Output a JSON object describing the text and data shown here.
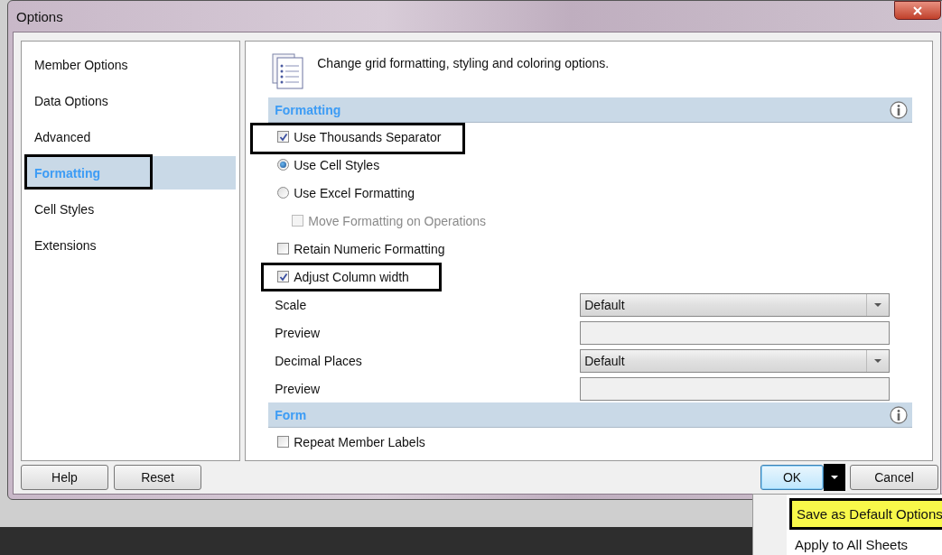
{
  "window": {
    "title": "Options"
  },
  "sidebar": {
    "items": [
      {
        "label": "Member Options",
        "selected": false,
        "highlighted": false
      },
      {
        "label": "Data Options",
        "selected": false,
        "highlighted": false
      },
      {
        "label": "Advanced",
        "selected": false,
        "highlighted": false
      },
      {
        "label": "Formatting",
        "selected": true,
        "highlighted": true
      },
      {
        "label": "Cell Styles",
        "selected": false,
        "highlighted": false
      },
      {
        "label": "Extensions",
        "selected": false,
        "highlighted": false
      }
    ]
  },
  "header": {
    "text": "Change grid formatting, styling and coloring options."
  },
  "sections": [
    {
      "title": "Formatting",
      "rows": [
        {
          "kind": "checkbox",
          "label": "Use Thousands Separator",
          "checked": true,
          "disabled": false,
          "highlighted": true
        },
        {
          "kind": "radio",
          "label": "Use Cell Styles",
          "selected": true,
          "disabled": false,
          "highlighted": false
        },
        {
          "kind": "radio",
          "label": "Use Excel Formatting",
          "selected": false,
          "disabled": false,
          "highlighted": false,
          "children": [
            {
              "kind": "checkbox",
              "label": "Move Formatting on Operations",
              "checked": false,
              "disabled": true,
              "highlighted": false
            }
          ]
        },
        {
          "kind": "checkbox",
          "label": "Retain Numeric Formatting",
          "checked": false,
          "disabled": false,
          "highlighted": false
        },
        {
          "kind": "checkbox",
          "label": "Adjust Column width",
          "checked": true,
          "disabled": false,
          "highlighted": true
        },
        {
          "kind": "dropdown",
          "label": "Scale",
          "value": "Default"
        },
        {
          "kind": "textbox",
          "label": "Preview"
        },
        {
          "kind": "dropdown",
          "label": "Decimal Places",
          "value": "Default"
        },
        {
          "kind": "textbox",
          "label": "Preview"
        }
      ]
    },
    {
      "title": "Form",
      "rows": [
        {
          "kind": "checkbox",
          "label": "Repeat Member Labels",
          "checked": false,
          "disabled": false,
          "highlighted": false
        }
      ]
    }
  ],
  "buttons_left": [
    "Help",
    "Reset"
  ],
  "ok_button": {
    "label": "OK",
    "focused": true
  },
  "split_arrow": {
    "highlighted": true
  },
  "cancel_button": {
    "label": "Cancel"
  },
  "menu": {
    "items": [
      {
        "label": "Save as Default Options",
        "highlighted": true
      },
      {
        "label": "Apply to All Sheets",
        "highlighted": false
      }
    ]
  }
}
